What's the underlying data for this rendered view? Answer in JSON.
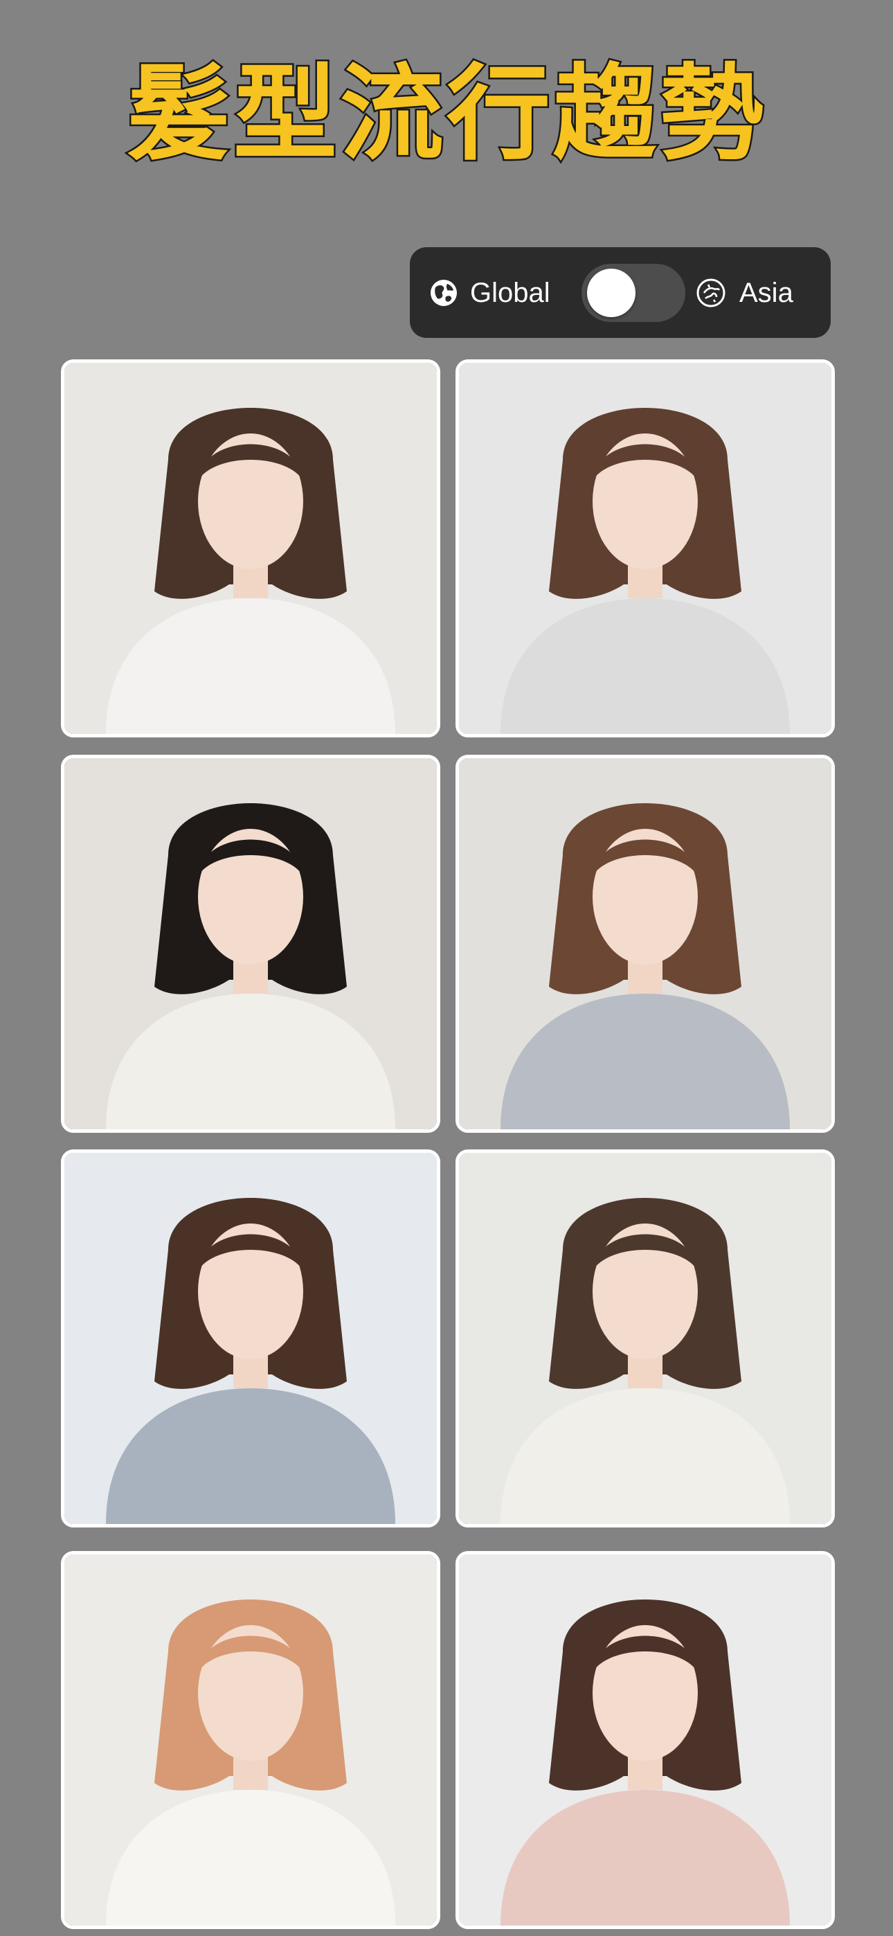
{
  "header": {
    "title": "髮型流行趨勢"
  },
  "region_toggle": {
    "left_label": "Global",
    "right_label": "Asia",
    "left_icon": "globe-icon",
    "right_icon": "asia-globe-icon",
    "selected": "Global"
  },
  "gallery": {
    "items": [
      {
        "name": "hairstyle-1",
        "hair": "#4a3328",
        "top": "#f3f2f0",
        "bg": "#e9e7e4"
      },
      {
        "name": "hairstyle-2",
        "hair": "#5e3f30",
        "top": "#dcdcdc",
        "bg": "#e6e6e6"
      },
      {
        "name": "hairstyle-3",
        "hair": "#1f1a18",
        "top": "#f1efea",
        "bg": "#e4e1dc"
      },
      {
        "name": "hairstyle-4",
        "hair": "#6b4734",
        "top": "#b8bcc4",
        "bg": "#e2e0dc"
      },
      {
        "name": "hairstyle-5",
        "hair": "#4a3227",
        "top": "#a8b2bf",
        "bg": "#e6eaee"
      },
      {
        "name": "hairstyle-6",
        "hair": "#4d382d",
        "top": "#f1efea",
        "bg": "#e8e8e5"
      },
      {
        "name": "hairstyle-7",
        "hair": "#d79a74",
        "top": "#f6f5f2",
        "bg": "#ecebe8"
      },
      {
        "name": "hairstyle-8",
        "hair": "#4b3329",
        "top": "#e8c9c2",
        "bg": "#ebebeb"
      }
    ]
  }
}
